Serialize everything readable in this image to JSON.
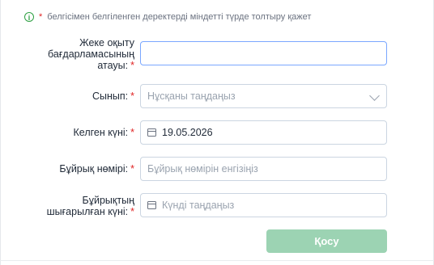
{
  "notice": {
    "icon": "info-icon",
    "star": "*",
    "text": "белгісімен белгіленген деректерді міндетті түрде толтыру қажет"
  },
  "required_mark": "*",
  "fields": [
    {
      "label_lines": [
        "Жеке оқыту",
        "бағдарламасының",
        "атауы:"
      ],
      "value": "",
      "placeholder": ""
    },
    {
      "label_lines": [
        "Сынып:"
      ],
      "value": "",
      "placeholder": "Нұсқаны таңдаңыз"
    },
    {
      "label_lines": [
        "Келген күні:"
      ],
      "value": "19.05.2026",
      "placeholder": ""
    },
    {
      "label_lines": [
        "Бұйрық нөмірі:"
      ],
      "value": "",
      "placeholder": "Бұйрық нөмірін енгізіңіз"
    },
    {
      "label_lines": [
        "Бұйрықтың",
        "шығарылған күні:"
      ],
      "value": "",
      "placeholder": "Күнді таңдаңыз"
    }
  ],
  "submit_label": "Қосу",
  "colors": {
    "accent": "#2ea043",
    "required": "#e02424",
    "submit_bg": "#9cd3b3"
  }
}
